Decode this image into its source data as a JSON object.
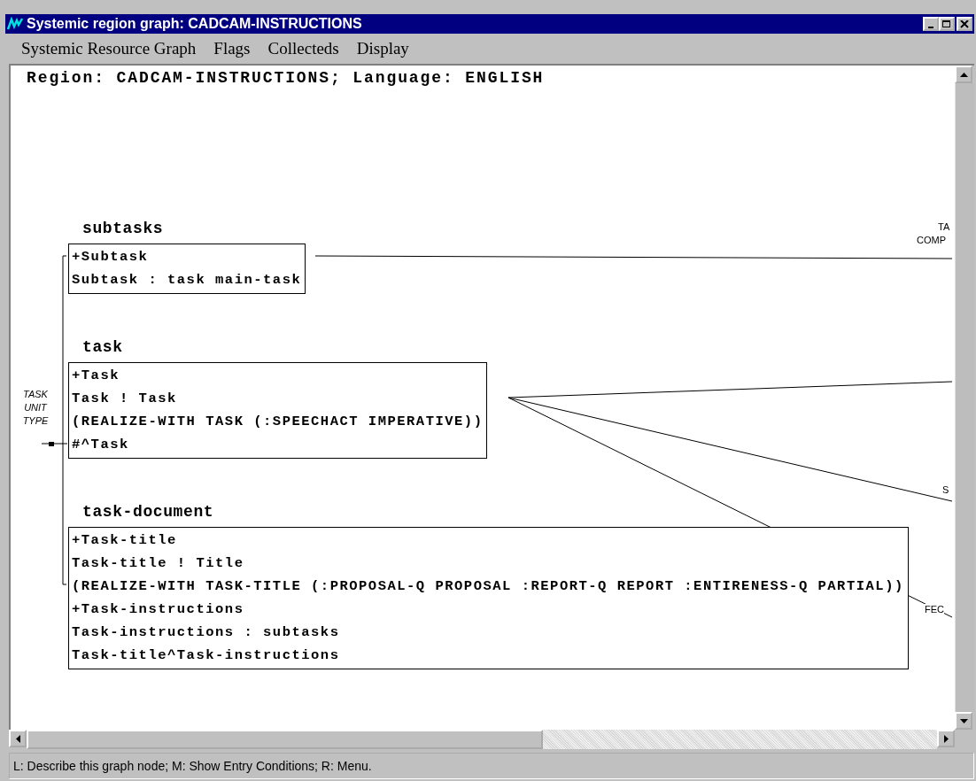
{
  "window": {
    "title": "Systemic region graph: CADCAM-INSTRUCTIONS"
  },
  "menu": [
    "Systemic Resource Graph",
    "Flags",
    "Collecteds",
    "Display"
  ],
  "header": "Region: CADCAM-INSTRUCTIONS; Language: ENGLISH",
  "nodes": [
    {
      "label": "subtasks",
      "lines": [
        "+Subtask",
        "Subtask : task main-task"
      ]
    },
    {
      "label": "task",
      "lines": [
        "+Task",
        "Task ! Task",
        "(REALIZE-WITH TASK (:SPEECHACT IMPERATIVE))",
        "#^Task"
      ]
    },
    {
      "label": "task-document",
      "lines": [
        "+Task-title",
        "Task-title ! Title",
        "(REALIZE-WITH TASK-TITLE (:PROPOSAL-Q PROPOSAL :REPORT-Q REPORT :ENTIRENESS-Q PARTIAL))",
        "+Task-instructions",
        "Task-instructions : subtasks",
        "Task-title^Task-instructions"
      ]
    }
  ],
  "side_label": "TASK UNIT TYPE",
  "edge_labels": [
    "TA",
    "COMP",
    "S",
    "FEC"
  ],
  "status_bar": "L: Describe this graph node; M: Show Entry Conditions; R: Menu."
}
